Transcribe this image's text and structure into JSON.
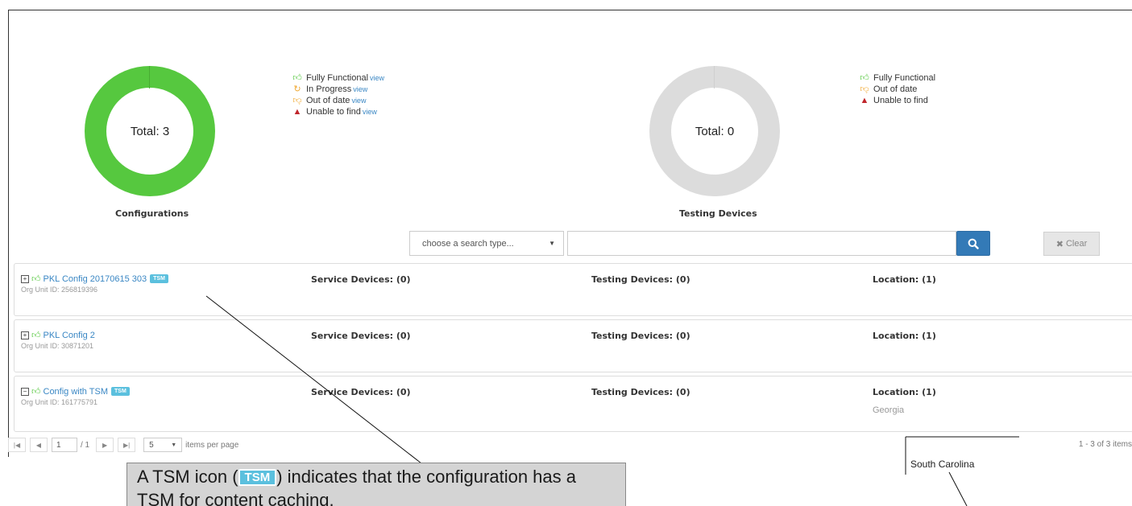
{
  "configurations_chart": {
    "total_text": "Total: 3",
    "label": "Configurations",
    "colors": {
      "functional": "#56c83f"
    },
    "legend": [
      {
        "icon": "thumbs-up-icon",
        "text": "Fully Functional",
        "link": "view"
      },
      {
        "icon": "refresh-icon",
        "text": "In Progress",
        "link": "view"
      },
      {
        "icon": "thumbs-down-icon",
        "text": "Out of date",
        "link": "view"
      },
      {
        "icon": "warning-icon",
        "text": "Unable to find",
        "link": "view"
      }
    ]
  },
  "testing_chart": {
    "total_text": "Total: 0",
    "label": "Testing Devices",
    "colors": {
      "empty": "#dcdcdc"
    },
    "legend": [
      {
        "icon": "thumbs-up-icon",
        "text": "Fully Functional"
      },
      {
        "icon": "thumbs-down-icon",
        "text": "Out of date"
      },
      {
        "icon": "warning-icon",
        "text": "Unable to find"
      }
    ]
  },
  "search": {
    "type_placeholder": "choose a search type...",
    "query_value": "",
    "clear_label": "Clear"
  },
  "configs": [
    {
      "name": "PKL Config 20170615 303",
      "tsm": "TSM",
      "org_unit": "Org Unit ID: 256819396",
      "expanded": false,
      "service_devices": "Service Devices: (0)",
      "testing_devices": "Testing Devices: (0)",
      "location": "Location: (1)",
      "location_detail": ""
    },
    {
      "name": "PKL Config 2",
      "tsm": "",
      "org_unit": "Org Unit ID: 30871201",
      "expanded": false,
      "service_devices": "Service Devices: (0)",
      "testing_devices": "Testing Devices: (0)",
      "location": "Location: (1)",
      "location_detail": ""
    },
    {
      "name": "Config with TSM",
      "tsm": "TSM",
      "org_unit": "Org Unit ID: 161775791",
      "expanded": true,
      "service_devices": "Service Devices: (0)",
      "testing_devices": "Testing Devices: (0)",
      "location": "Location: (1)",
      "location_detail": "Georgia"
    }
  ],
  "pager": {
    "page": "1",
    "of_text": "/ 1",
    "page_size": "5",
    "per_page_text": "items per page",
    "info": "1 - 3 of 3 items"
  },
  "annotations": {
    "tsm_callout_prefix": "A TSM icon (",
    "tsm_callout_badge": "TSM",
    "tsm_callout_suffix": ") indicates that the configuration has a TSM for content caching.",
    "location_callout": "South Carolina"
  }
}
